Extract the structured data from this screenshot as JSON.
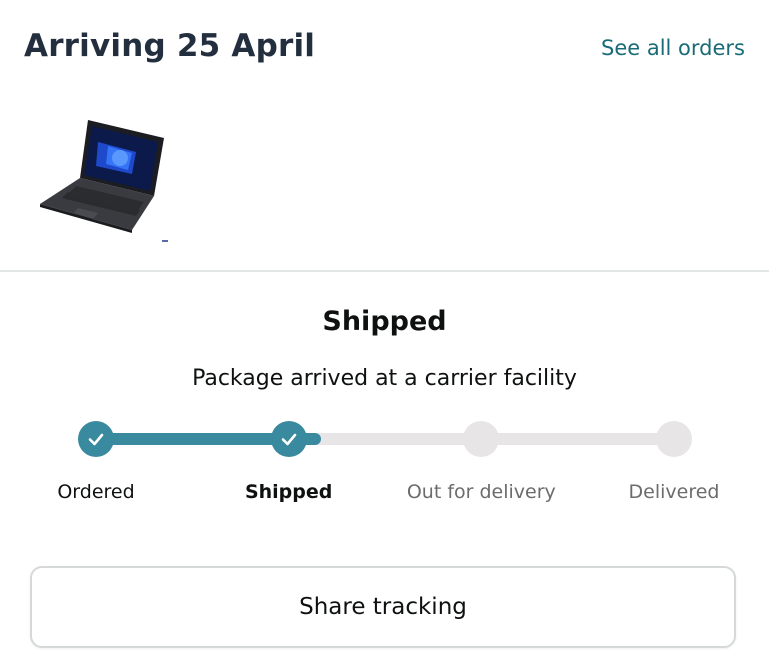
{
  "header": {
    "title": "Arriving 25 April",
    "see_all_orders_label": "See all orders",
    "link_color": "#1a6b77"
  },
  "product": {
    "image_icon": "laptop-image"
  },
  "status": {
    "title": "Shipped",
    "detail": "Package arrived at a carrier facility"
  },
  "tracker": {
    "progress_percent": 39,
    "steps": [
      {
        "label": "Ordered",
        "state": "done"
      },
      {
        "label": "Shipped",
        "state": "current"
      },
      {
        "label": "Out for delivery",
        "state": "todo"
      },
      {
        "label": "Delivered",
        "state": "todo"
      }
    ],
    "done_color": "#3a8a9f",
    "todo_color": "#e7e5e6",
    "check_icon": "check-icon"
  },
  "actions": {
    "share_tracking_label": "Share tracking"
  }
}
